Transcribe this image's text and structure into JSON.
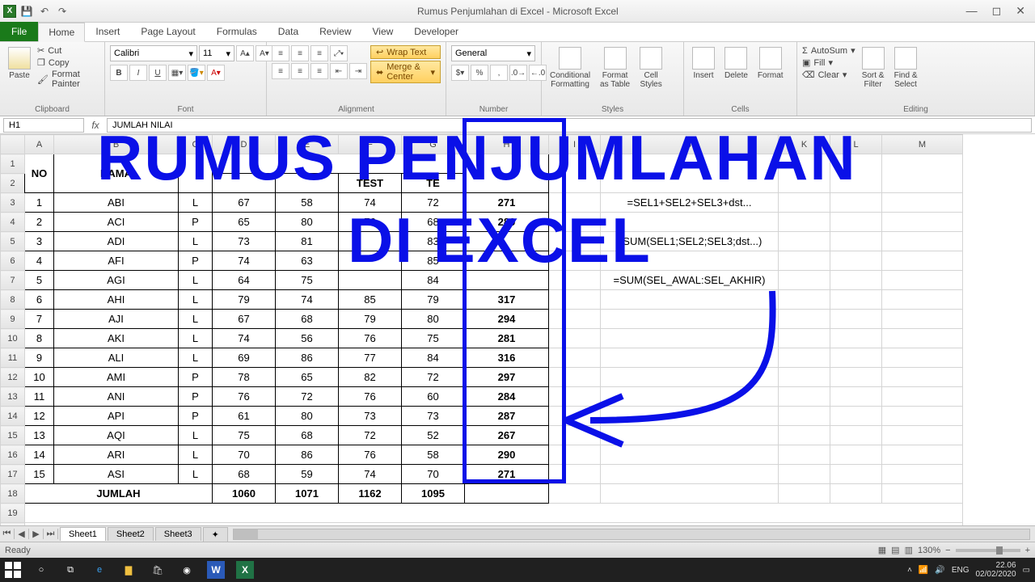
{
  "window": {
    "title": "Rumus Penjumlahan di Excel - Microsoft Excel",
    "min": "—",
    "max": "◻",
    "close": "✕"
  },
  "tabs": {
    "file": "File",
    "list": [
      "Home",
      "Insert",
      "Page Layout",
      "Formulas",
      "Data",
      "Review",
      "View",
      "Developer"
    ],
    "active": "Home"
  },
  "ribbon": {
    "clipboard": {
      "label": "Clipboard",
      "paste": "Paste",
      "cut": "Cut",
      "copy": "Copy",
      "painter": "Format Painter"
    },
    "font": {
      "label": "Font",
      "name": "Calibri",
      "size": "11",
      "bold": "B",
      "italic": "I",
      "underline": "U"
    },
    "alignment": {
      "label": "Alignment",
      "wrap": "Wrap Text",
      "merge": "Merge & Center"
    },
    "number": {
      "label": "Number",
      "format": "General"
    },
    "styles": {
      "label": "Styles",
      "cond": "Conditional\nFormatting",
      "table": "Format\nas Table",
      "cell": "Cell\nStyles"
    },
    "cells": {
      "label": "Cells",
      "insert": "Insert",
      "delete": "Delete",
      "format": "Format"
    },
    "editing": {
      "label": "Editing",
      "autosum": "AutoSum",
      "fill": "Fill",
      "clear": "Clear",
      "sort": "Sort &\nFilter",
      "find": "Find &\nSelect"
    }
  },
  "formula_bar": {
    "name": "H1",
    "fx": "fx",
    "value": "JUMLAH NILAI"
  },
  "columns": [
    "",
    "A",
    "B",
    "C",
    "D",
    "E",
    "F",
    "G",
    "H",
    "I",
    "J",
    "K",
    "L",
    "M"
  ],
  "header_row1": {
    "no": "NO",
    "nama": "NAMA",
    "jk": "",
    "nilai": "",
    "jumlah": ""
  },
  "header_row2": {
    "t1": "",
    "t2": "",
    "t3": "TEST",
    "t4": "TE",
    "nilai": "NILAI"
  },
  "rows": [
    {
      "n": 1,
      "no": "1",
      "nm": "ABI",
      "jk": "L",
      "t1": 67,
      "t2": 58,
      "t3": 74,
      "t4": 72,
      "sum": 271
    },
    {
      "n": 2,
      "no": "2",
      "nm": "ACI",
      "jk": "P",
      "t1": 65,
      "t2": 80,
      "t3": 76,
      "t4": 68,
      "sum": 289
    },
    {
      "n": 3,
      "no": "3",
      "nm": "ADI",
      "jk": "L",
      "t1": 73,
      "t2": 81,
      "t3": "",
      "t4": 83,
      "sum": ""
    },
    {
      "n": 4,
      "no": "4",
      "nm": "AFI",
      "jk": "P",
      "t1": 74,
      "t2": 63,
      "t3": "",
      "t4": 85,
      "sum": ""
    },
    {
      "n": 5,
      "no": "5",
      "nm": "AGI",
      "jk": "L",
      "t1": 64,
      "t2": 75,
      "t3": "",
      "t4": 84,
      "sum": ""
    },
    {
      "n": 6,
      "no": "6",
      "nm": "AHI",
      "jk": "L",
      "t1": 79,
      "t2": 74,
      "t3": 85,
      "t4": 79,
      "sum": 317
    },
    {
      "n": 7,
      "no": "7",
      "nm": "AJI",
      "jk": "L",
      "t1": 67,
      "t2": 68,
      "t3": 79,
      "t4": 80,
      "sum": 294
    },
    {
      "n": 8,
      "no": "8",
      "nm": "AKI",
      "jk": "L",
      "t1": 74,
      "t2": 56,
      "t3": 76,
      "t4": 75,
      "sum": 281
    },
    {
      "n": 9,
      "no": "9",
      "nm": "ALI",
      "jk": "L",
      "t1": 69,
      "t2": 86,
      "t3": 77,
      "t4": 84,
      "sum": 316
    },
    {
      "n": 10,
      "no": "10",
      "nm": "AMI",
      "jk": "P",
      "t1": 78,
      "t2": 65,
      "t3": 82,
      "t4": 72,
      "sum": 297
    },
    {
      "n": 11,
      "no": "11",
      "nm": "ANI",
      "jk": "P",
      "t1": 76,
      "t2": 72,
      "t3": 76,
      "t4": 60,
      "sum": 284
    },
    {
      "n": 12,
      "no": "12",
      "nm": "API",
      "jk": "P",
      "t1": 61,
      "t2": 80,
      "t3": 73,
      "t4": 73,
      "sum": 287
    },
    {
      "n": 13,
      "no": "13",
      "nm": "AQI",
      "jk": "L",
      "t1": 75,
      "t2": 68,
      "t3": 72,
      "t4": 52,
      "sum": 267
    },
    {
      "n": 14,
      "no": "14",
      "nm": "ARI",
      "jk": "L",
      "t1": 70,
      "t2": 86,
      "t3": 76,
      "t4": 58,
      "sum": 290
    },
    {
      "n": 15,
      "no": "15",
      "nm": "ASI",
      "jk": "L",
      "t1": 68,
      "t2": 59,
      "t3": 74,
      "t4": 70,
      "sum": 271
    }
  ],
  "totals": {
    "label": "JUMLAH",
    "t1": 1060,
    "t2": 1071,
    "t3": 1162,
    "t4": 1095
  },
  "side_formulas": {
    "f1": "=SEL1+SEL2+SEL3+dst...",
    "f2": "=SUM(SEL1;SEL2;SEL3;dst...)",
    "f3": "=SUM(SEL_AWAL:SEL_AKHIR)"
  },
  "sheets": {
    "s1": "Sheet1",
    "s2": "Sheet2",
    "s3": "Sheet3"
  },
  "status": {
    "ready": "Ready",
    "zoom": "130%"
  },
  "taskbar": {
    "lang": "ENG",
    "time": "22.06",
    "date": "02/02/2020"
  },
  "overlay": {
    "l1": "RUMUS PENJUMLAHAN",
    "l2": "DI EXCEL"
  }
}
